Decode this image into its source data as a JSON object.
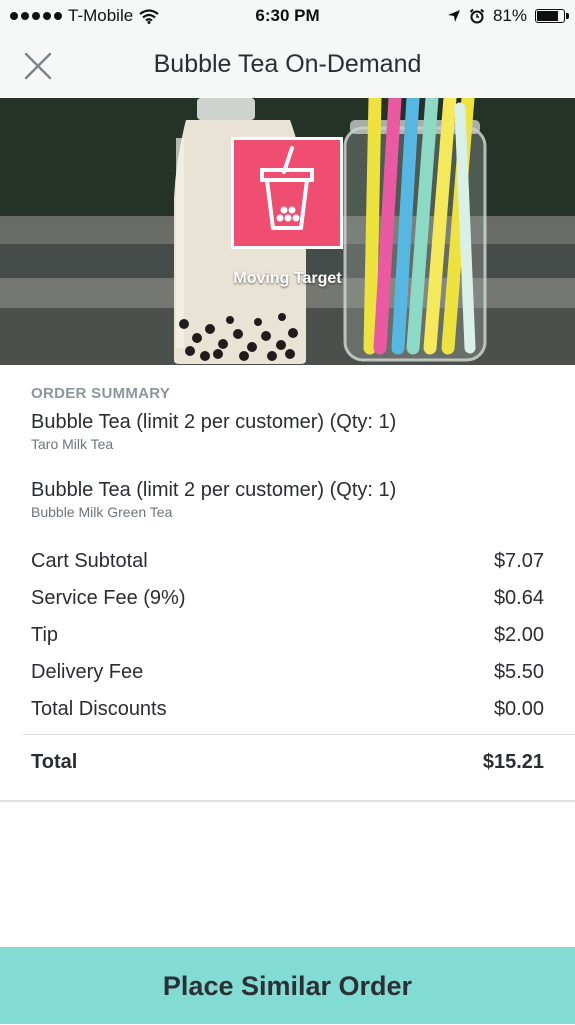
{
  "status_bar": {
    "carrier": "T-Mobile",
    "time": "6:30 PM",
    "battery": "81%",
    "battery_level": 0.81,
    "icons": [
      "signal-dots-icon",
      "wifi-icon",
      "location-arrow-icon",
      "alarm-clock-icon",
      "battery-icon"
    ]
  },
  "header": {
    "title": "Bubble Tea On-Demand",
    "close_icon": "close-icon"
  },
  "hero": {
    "brand_name": "Moving Target",
    "logo_icon": "bubble-tea-cup-icon",
    "logo_color": "#ef4e71"
  },
  "order_summary": {
    "label": "ORDER SUMMARY",
    "items": [
      {
        "name": "Bubble Tea (limit 2 per customer) (Qty: 1)",
        "variant": "Taro Milk Tea"
      },
      {
        "name": "Bubble Tea (limit 2 per customer) (Qty: 1)",
        "variant": "Bubble Milk Green Tea"
      }
    ],
    "lines": [
      {
        "label": "Cart Subtotal",
        "amount": "$7.07"
      },
      {
        "label": "Service Fee (9%)",
        "amount": "$0.64"
      },
      {
        "label": "Tip",
        "amount": "$2.00"
      },
      {
        "label": "Delivery Fee",
        "amount": "$5.50"
      },
      {
        "label": "Total Discounts",
        "amount": "$0.00"
      }
    ],
    "total": {
      "label": "Total",
      "amount": "$15.21"
    }
  },
  "footer": {
    "cta_label": "Place Similar Order",
    "cta_color": "#83dcd4"
  }
}
